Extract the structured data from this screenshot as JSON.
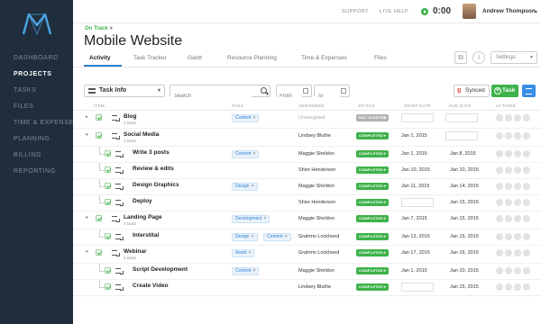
{
  "sidebar": {
    "items": [
      {
        "label": "DASHBOARD",
        "active": false
      },
      {
        "label": "PROJECTS",
        "active": true
      },
      {
        "label": "TASKS",
        "active": false
      },
      {
        "label": "FILES",
        "active": false
      },
      {
        "label": "TIME & EXPENSE",
        "active": false
      },
      {
        "label": "PLANNING",
        "active": false
      },
      {
        "label": "BILLING",
        "active": false
      },
      {
        "label": "REPORTING",
        "active": false
      }
    ]
  },
  "topbar": {
    "support": "SUPPORT",
    "live_help": "LIVE HELP",
    "timer": "0:00",
    "user_name": "Andrew Thompson"
  },
  "header": {
    "status": "On Track",
    "title": "Mobile Website",
    "tabs": [
      "Activity",
      "Task Tracker",
      "Gantt",
      "Resource Planning",
      "Time & Expenses",
      "Files"
    ],
    "settings": "Settings"
  },
  "toolbar": {
    "task_info": "Task Info",
    "search_placeholder": "Search",
    "from_placeholder": "From",
    "to_placeholder": "To",
    "synced": "Synced",
    "add_task": "Task"
  },
  "table": {
    "headers": {
      "item": "ITEM",
      "tags": "TAGS",
      "assignees": "ASSIGNEES",
      "status": "STATUS",
      "start": "START DATE",
      "due": "DUE DATE",
      "actions": "ACTIONS"
    },
    "rows": [
      {
        "name": "Blog",
        "sub": "3 tasks",
        "tags": [
          "Content"
        ],
        "assignee": "Unassigned",
        "status": "NOT STARTED",
        "start": "",
        "due": "",
        "parent": true
      },
      {
        "name": "Social Media",
        "sub": "3 tasks",
        "tags": [],
        "assignee": "Lindsey Bluthe",
        "status": "COMPLETED",
        "start": "Jan 1, 2015",
        "due": "",
        "parent": true
      },
      {
        "name": "Write 3 posts",
        "sub": "",
        "tags": [
          "Content"
        ],
        "assignee": "Maggie Sheldon",
        "status": "COMPLETED",
        "start": "Jan 1, 2015",
        "due": "Jan 8, 2015",
        "parent": false
      },
      {
        "name": "Review & edits",
        "sub": "",
        "tags": [],
        "assignee": "Shire Henderson",
        "status": "COMPLETED",
        "start": "Jan 10, 2015",
        "due": "Jan 10, 2015",
        "parent": false
      },
      {
        "name": "Design Graphics",
        "sub": "",
        "tags": [
          "Design"
        ],
        "assignee": "Maggie Sheldon",
        "status": "COMPLETED",
        "start": "Jan 11, 2015",
        "due": "Jan 14, 2015",
        "parent": false
      },
      {
        "name": "Deploy",
        "sub": "",
        "tags": [],
        "assignee": "Shire Henderson",
        "status": "COMPLETED",
        "start": "",
        "due": "Jan 15, 2015",
        "parent": false
      },
      {
        "name": "Landing Page",
        "sub": "3 tasks",
        "tags": [
          "Development"
        ],
        "assignee": "Maggie Sheldon",
        "status": "COMPLETED",
        "start": "Jan 7, 2015",
        "due": "Jan 15, 2015",
        "parent": true
      },
      {
        "name": "Interstital",
        "sub": "",
        "tags": [
          "Design",
          "Content"
        ],
        "assignee": "Grahmn Lockheed",
        "status": "COMPLETED",
        "start": "Jan 12, 2015",
        "due": "Jan 15, 2015",
        "parent": false
      },
      {
        "name": "Webinar",
        "sub": "3 tasks",
        "tags": [
          "Asset"
        ],
        "assignee": "Grahmn Lockheed",
        "status": "COMPLETED",
        "start": "Jan 17, 2015",
        "due": "Jan 16, 2015",
        "parent": true
      },
      {
        "name": "Script Development",
        "sub": "",
        "tags": [
          "Content"
        ],
        "assignee": "Maggie Sheldon",
        "status": "COMPLETED",
        "start": "Jan 1, 2015",
        "due": "Jan 10, 2015",
        "parent": false
      },
      {
        "name": "Create Video",
        "sub": "",
        "tags": [],
        "assignee": "Lindsey Bluthe",
        "status": "COMPLETED",
        "start": "",
        "due": "Jan 15, 2015",
        "parent": false
      }
    ]
  },
  "colors": {
    "sidebar_bg": "#1f2d3d",
    "accent_green": "#3eb24a",
    "accent_blue": "#2c7fd6"
  }
}
